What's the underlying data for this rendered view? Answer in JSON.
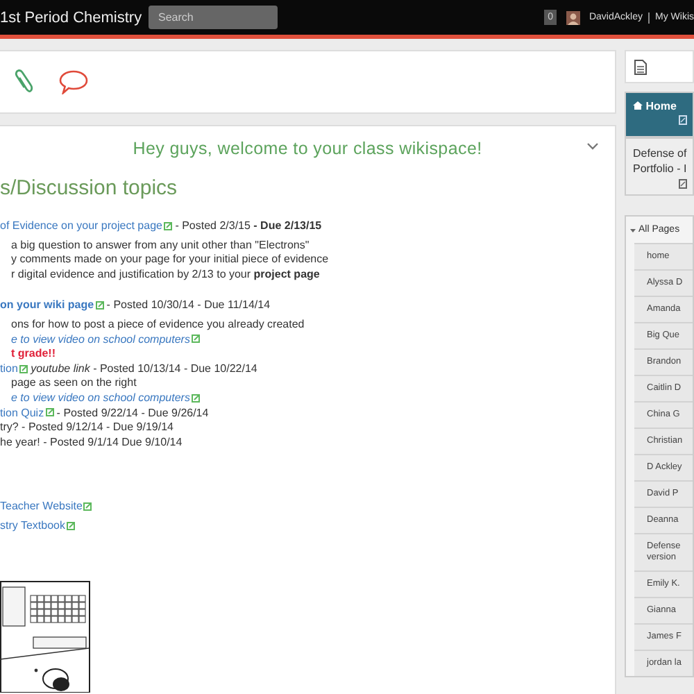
{
  "top_bar": {
    "title": "1st Period Chemistry",
    "search": {
      "placeholder": "Search"
    },
    "notifications": "0",
    "user": "DavidAckley",
    "links": [
      "My Wikis"
    ]
  },
  "content": {
    "banner": "Hey guys, welcome to your class wikispace!",
    "heading": "s/Discussion topics",
    "groups": [
      [
        {
          "kind": "item",
          "parts": [
            {
              "kind": "link",
              "text": "of Evidence on your project page",
              "external": true
            },
            {
              "kind": "text",
              "text": " - Posted 2/3/15 **- Due 2/13/15**"
            }
          ]
        },
        {
          "kind": "sub",
          "parts": [
            {
              "kind": "text",
              "text": "a big question to answer from any unit other than \"Electrons\""
            }
          ]
        },
        {
          "kind": "sub",
          "parts": [
            {
              "kind": "text",
              "text": "y comments made on your page for your initial piece of evidence"
            }
          ]
        },
        {
          "kind": "sub",
          "parts": [
            {
              "kind": "text",
              "text": "r digital evidence and justification by 2/13 to your **project page**"
            }
          ]
        }
      ],
      [
        {
          "kind": "item",
          "parts": [
            {
              "kind": "link",
              "text": "**on your wiki page**",
              "external": true
            },
            {
              "kind": "text",
              "text": " - Posted 10/30/14 - Due 11/14/14"
            }
          ]
        },
        {
          "kind": "sub",
          "parts": [
            {
              "kind": "text",
              "text": "ons for how to post a piece of evidence you already created"
            }
          ]
        },
        {
          "kind": "sub",
          "parts": [
            {
              "kind": "link",
              "text": "*e to view video on school computers*",
              "external": true
            }
          ]
        },
        {
          "kind": "sub",
          "parts": [
            {
              "kind": "alert",
              "text": "t grade!!"
            }
          ]
        },
        {
          "kind": "item",
          "parts": [
            {
              "kind": "link",
              "text": "tion",
              "external": true
            },
            {
              "kind": "text",
              "text": " *youtube link* - Posted 10/13/14 - Due 10/22/14"
            }
          ]
        },
        {
          "kind": "sub",
          "parts": [
            {
              "kind": "text",
              "text": "page as seen on the right"
            }
          ]
        },
        {
          "kind": "sub",
          "parts": [
            {
              "kind": "link",
              "text": "*e to view video on school computers*",
              "external": true
            }
          ]
        },
        {
          "kind": "item",
          "parts": [
            {
              "kind": "link",
              "text": "tion Quiz",
              "external": true
            },
            {
              "kind": "text",
              "text": " - Posted 9/22/14 - Due 9/26/14"
            }
          ]
        },
        {
          "kind": "item",
          "parts": [
            {
              "kind": "text",
              "text": "try? - Posted 9/12/14 - Due 9/19/14"
            }
          ]
        },
        {
          "kind": "item",
          "parts": [
            {
              "kind": "text",
              "text": "he year! - Posted 9/1/14 Due 9/10/14"
            }
          ]
        }
      ],
      [
        {
          "kind": "item",
          "parts": [
            {
              "kind": "link",
              "text": "Teacher Website",
              "external": true
            }
          ]
        },
        {
          "kind": "item",
          "parts": [
            {
              "kind": "link",
              "text": "stry Textbook",
              "external": true
            }
          ]
        }
      ]
    ],
    "figure": {
      "kind": "picture"
    }
  },
  "sidebar": {
    "nav": [
      {
        "label": "Home",
        "selected": true
      },
      {
        "label": "Defense of Portfolio - I",
        "selected": false
      }
    ],
    "all_pages": {
      "label": "All Pages",
      "expanded": true,
      "items": [
        "home",
        "Alyssa D",
        "Amanda",
        "Big Que",
        "Brandon",
        "Caitlin D",
        "China G",
        "Christian",
        "D Ackley",
        "David P",
        "Deanna",
        "Defense version",
        "Emily K.",
        "Gianna",
        "James F",
        "jordan la"
      ]
    }
  }
}
